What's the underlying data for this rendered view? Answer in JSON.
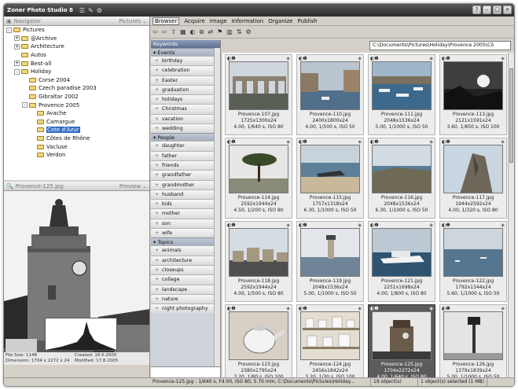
{
  "app": {
    "title": "Zoner Photo Studio 8"
  },
  "navigator": {
    "header": "Navigator",
    "dropdown": "Pictures",
    "tree": [
      {
        "label": "Pictures",
        "toggle": "-",
        "indent": 0
      },
      {
        "label": "@Archive",
        "toggle": "+",
        "indent": 1
      },
      {
        "label": "Architecture",
        "toggle": "+",
        "indent": 1
      },
      {
        "label": "Autos",
        "toggle": "",
        "indent": 1
      },
      {
        "label": "Best-all",
        "toggle": "+",
        "indent": 1
      },
      {
        "label": "Holiday",
        "toggle": "-",
        "indent": 1
      },
      {
        "label": "Corse 2004",
        "toggle": "",
        "indent": 2
      },
      {
        "label": "Czech paradise 2003",
        "toggle": "",
        "indent": 2
      },
      {
        "label": "Gibraltar 2002",
        "toggle": "",
        "indent": 2
      },
      {
        "label": "Provence 2005",
        "toggle": "-",
        "indent": 2
      },
      {
        "label": "Avache",
        "toggle": "",
        "indent": 3
      },
      {
        "label": "Camargue",
        "toggle": "",
        "indent": 3
      },
      {
        "label": "Cote d'Azur",
        "toggle": "",
        "indent": 3,
        "selected": true
      },
      {
        "label": "Côtes de Rhône",
        "toggle": "",
        "indent": 3
      },
      {
        "label": "Vacluse",
        "toggle": "",
        "indent": 3
      },
      {
        "label": "Verdon",
        "toggle": "",
        "indent": 3
      }
    ]
  },
  "preview": {
    "filename": "Provence-125.jpg",
    "dropdown": "Preview",
    "info": {
      "size": "File Size: 114B",
      "dimension": "Dimension: 1704 x 2272 x 24",
      "created": "Created: 18.6.2005",
      "modified": "Modified: 17.8.2005"
    }
  },
  "menu": {
    "tabs": [
      "Browser",
      "Acquire",
      "Image",
      "Information",
      "Organize",
      "Publish"
    ]
  },
  "toolbar": {
    "icons": [
      "back-icon",
      "forward-icon",
      "up-folder-icon",
      "view-icon",
      "rotate-icon",
      "copy-icon",
      "move-icon",
      "tag-icon",
      "columns-icon",
      "sort-icon",
      "filter-icon"
    ],
    "path": "C:\\Documents\\Pictures\\Holiday\\Provence 2005\\Cô"
  },
  "keywords": {
    "header": "Keywords",
    "groups": [
      {
        "name": "Events",
        "items": [
          "birthday",
          "celebration",
          "Easter",
          "graduation",
          "holidays",
          "Christmas",
          "vacation",
          "wedding"
        ]
      },
      {
        "name": "People",
        "items": [
          "daughter",
          "father",
          "friends",
          "grandfather",
          "grandmother",
          "husband",
          "kids",
          "mother",
          "son",
          "wife"
        ]
      },
      {
        "name": "Topics",
        "items": [
          "animals",
          "architecture",
          "closeups",
          "collage",
          "landscape",
          "nature",
          "night photography"
        ]
      }
    ]
  },
  "thumbnails": [
    {
      "name": "Provence-107.jpg",
      "dims": "1725x1300x24",
      "exif": "4.00, 1/640 s, ISO 80",
      "scene": "aqueduct"
    },
    {
      "name": "Provence-110.jpg",
      "dims": "2400x1800x24",
      "exif": "4.00, 1/500 s, ISO 50",
      "scene": "harbor"
    },
    {
      "name": "Provence-111.jpg",
      "dims": "2048x1536x24",
      "exif": "5.00, 1/1000 s, ISO 50",
      "scene": "boats"
    },
    {
      "name": "Provence-113.jpg",
      "dims": "2121x1591x24",
      "exif": "3.60, 1/850 s, ISO 100",
      "scene": "sunset"
    },
    {
      "name": "Provence-114.jpg",
      "dims": "2592x1944x24",
      "exif": "4.50, 1/200 s, ISO 80",
      "scene": "pine"
    },
    {
      "name": "Provence-115.jpg",
      "dims": "1757x1318x24",
      "exif": "6.30, 1/1000 s, ISO 50",
      "scene": "beach"
    },
    {
      "name": "Provence-116.jpg",
      "dims": "2048x1536x24",
      "exif": "6.30, 1/1000 s, ISO 50",
      "scene": "coast"
    },
    {
      "name": "Provence-117.jpg",
      "dims": "1944x2592x24",
      "exif": "4.00, 1/320 s, ISO 80",
      "scene": "rock"
    },
    {
      "name": "Provence-118.jpg",
      "dims": "2592x1944x24",
      "exif": "4.00, 1/500 s, ISO 80",
      "scene": "village"
    },
    {
      "name": "Provence-119.jpg",
      "dims": "2048x1536x24",
      "exif": "5.00, 1/1000 s, ISO 50",
      "scene": "lighthouse"
    },
    {
      "name": "Provence-121.jpg",
      "dims": "2251x1698x24",
      "exif": "4.00, 1/800 s, ISO 80",
      "scene": "yacht"
    },
    {
      "name": "Provence-122.jpg",
      "dims": "1792x1344x24",
      "exif": "5.60, 1/1000 s, ISO 50",
      "scene": "sea"
    },
    {
      "name": "Provence-123.jpg",
      "dims": "2380x1795x24",
      "exif": "3.20, 1/80 s, ISO 100",
      "scene": "teapot"
    },
    {
      "name": "Provence-124.jpg",
      "dims": "2456x1842x24",
      "exif": "3.20, 1/30 s, ISO 100",
      "scene": "shelf"
    },
    {
      "name": "Provence-125.jpg",
      "dims": "1704x2272x24",
      "exif": "4.00, 1/640 s, ISO 80",
      "scene": "tower",
      "selected": true
    },
    {
      "name": "Provence-126.jpg",
      "dims": "1379x1839x24",
      "exif": "5.00, 1/1000 s, ISO 50",
      "scene": "lamp"
    }
  ],
  "status": {
    "info": "Provence-125.jpg : 1/640 s, F4.00, ISO 80, 5.70 mm, C:\\Documents\\Pictures\\Holiday...",
    "count": "19 object(s)",
    "selection": "1 object(s) selected (1 MB)"
  },
  "colors": {
    "selection": "#316ac5",
    "keyword_header": "#6f7f9c"
  }
}
